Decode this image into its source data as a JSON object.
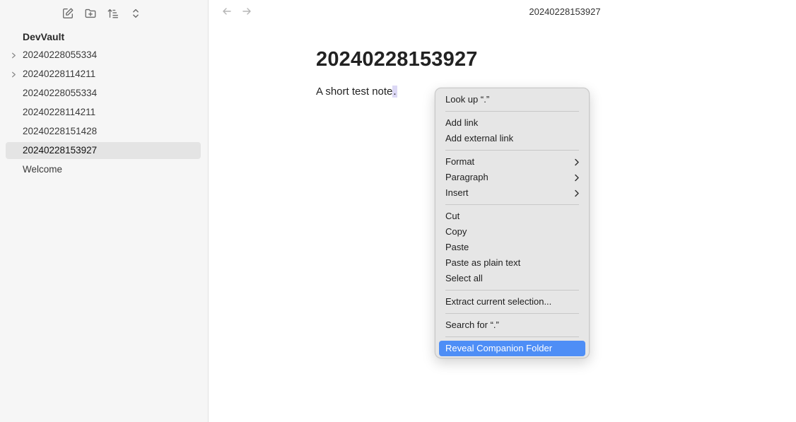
{
  "sidebar": {
    "vault_name": "DevVault",
    "toolbar": {
      "icons": [
        "new-note-icon",
        "new-folder-icon",
        "sort-icon",
        "expand-collapse-icon"
      ]
    },
    "items": [
      {
        "label": "20240228055334",
        "folder": true,
        "active": false
      },
      {
        "label": "20240228114211",
        "folder": true,
        "active": false
      },
      {
        "label": "20240228055334",
        "folder": false,
        "active": false
      },
      {
        "label": "20240228114211",
        "folder": false,
        "active": false
      },
      {
        "label": "20240228151428",
        "folder": false,
        "active": false
      },
      {
        "label": "20240228153927",
        "folder": false,
        "active": true
      },
      {
        "label": "Welcome",
        "folder": false,
        "active": false
      }
    ]
  },
  "main": {
    "tab_title": "20240228153927",
    "note_title": "20240228153927",
    "body_text": "A short test note",
    "body_selected": "."
  },
  "context_menu": {
    "look_up": "Look up “.”",
    "add_link": "Add link",
    "add_external_link": "Add external link",
    "format": "Format",
    "paragraph": "Paragraph",
    "insert": "Insert",
    "cut": "Cut",
    "copy": "Copy",
    "paste": "Paste",
    "paste_plain": "Paste as plain text",
    "select_all": "Select all",
    "extract_selection": "Extract current selection...",
    "search_for": "Search for “.”",
    "reveal_companion": "Reveal Companion Folder"
  },
  "colors": {
    "highlight": "#4e8ef6",
    "selection": "#dcd8f5",
    "sidebar_bg": "#f6f6f6"
  }
}
